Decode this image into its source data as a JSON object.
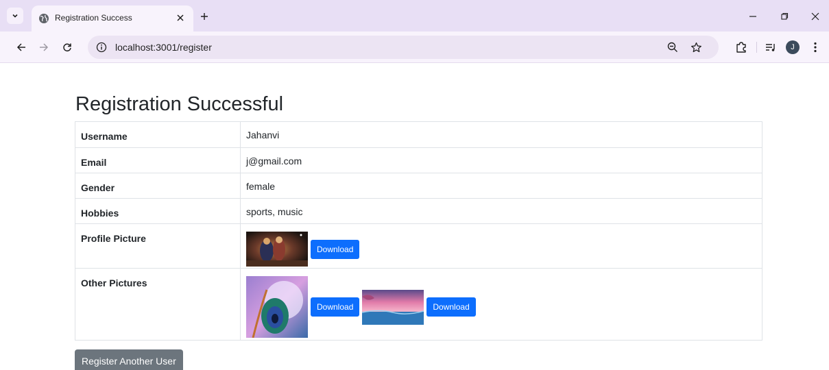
{
  "browser": {
    "tab_title": "Registration Success",
    "url": "localhost:3001/register",
    "avatar_letter": "J"
  },
  "page": {
    "title": "Registration Successful",
    "rows": [
      {
        "label": "Username",
        "value": "Jahanvi"
      },
      {
        "label": "Email",
        "value": "j@gmail.com"
      },
      {
        "label": "Gender",
        "value": "female"
      },
      {
        "label": "Hobbies",
        "value": "sports, music"
      },
      {
        "label": "Profile Picture"
      },
      {
        "label": "Other Pictures"
      }
    ],
    "download_label": "Download",
    "register_again_label": "Register Another User"
  },
  "colors": {
    "primary": "#0d6efd",
    "secondary": "#6c757d",
    "chrome_tabbar": "#e8dff5"
  }
}
